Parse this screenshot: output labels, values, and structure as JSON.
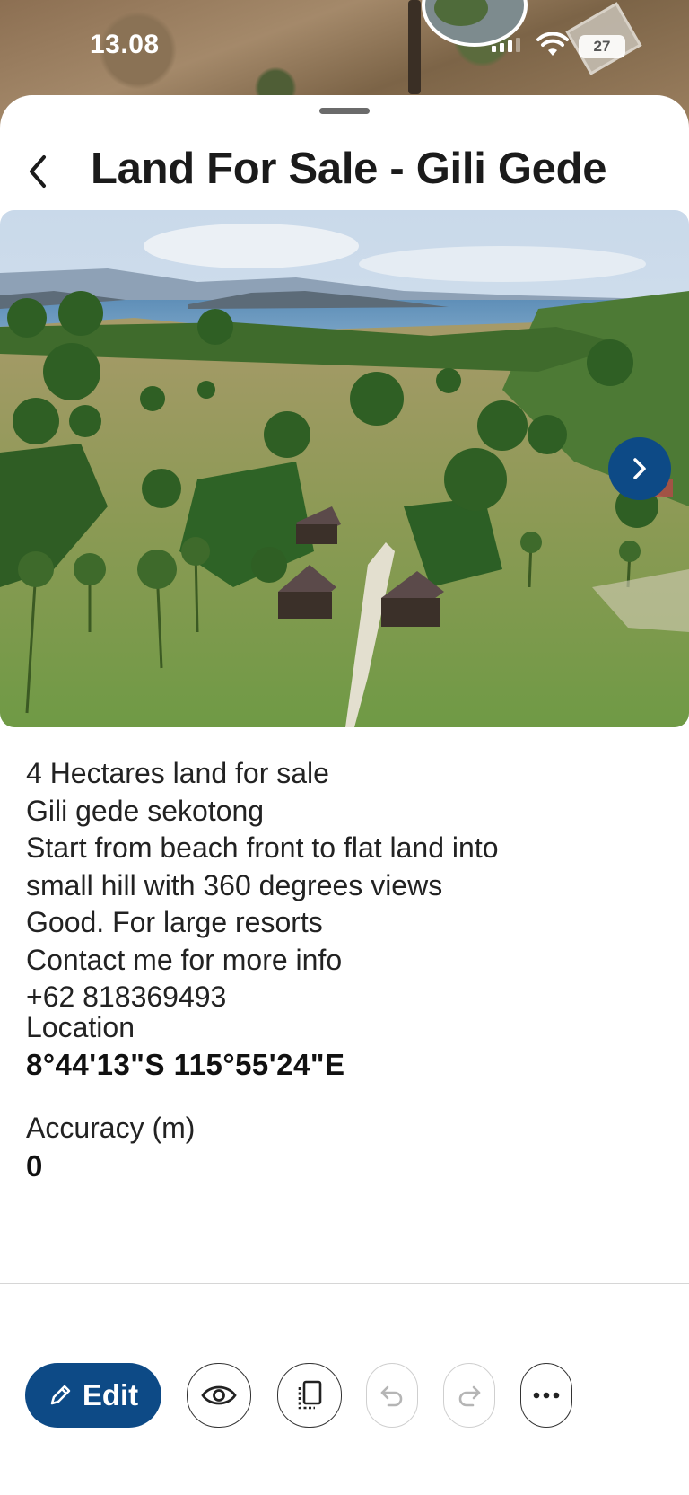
{
  "status_bar": {
    "time": "13.08",
    "battery": "27"
  },
  "header": {
    "title": "Land For Sale - Gili Gede"
  },
  "description": {
    "lines": [
      "4 Hectares land for sale",
      "Gili gede sekotong",
      "Start from beach front to flat land into",
      "small hill with 360 degrees views",
      "Good. For large resorts",
      "Contact me for more info",
      "+62 818369493"
    ]
  },
  "fields": {
    "location_label": "Location",
    "location_value": "8°44'13\"S 115°55'24\"E",
    "accuracy_label": "Accuracy (m)",
    "accuracy_value": "0"
  },
  "toolbar": {
    "edit_label": "Edit"
  },
  "colors": {
    "accent": "#0d4a86",
    "text": "#1b1b1b"
  },
  "icons": [
    "back-chevron-icon",
    "next-chevron-icon",
    "pencil-icon",
    "eye-icon",
    "copy-icon",
    "undo-icon",
    "redo-icon",
    "more-icon"
  ]
}
